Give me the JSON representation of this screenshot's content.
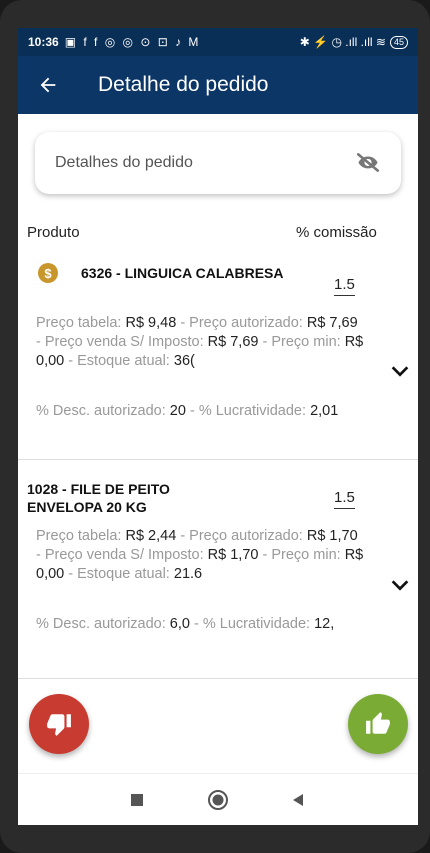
{
  "status_bar": {
    "time": "10:36",
    "left_icons": "▣ f f ◎ ◎ ⊙ ⊡ ♪ M",
    "right_icons": "✱ ⚡ ◷ .ıll .ıll ≋",
    "battery": "45"
  },
  "app_bar": {
    "title": "Detalhe do pedido"
  },
  "details_card": {
    "label": "Detalhes do pedido"
  },
  "columns": {
    "product": "Produto",
    "commission": "% comissão"
  },
  "products": [
    {
      "name": "6326 - LINGUICA CALABRESA",
      "commission": "1.5",
      "labels": {
        "preco_tabela": "Preço tabela:",
        "preco_autorizado": "- Preço autorizado:",
        "preco_venda": "- Preço venda S/ Imposto:",
        "preco_min": "- Preço min:",
        "estoque": "- Estoque atual:",
        "desc": "% Desc. autorizado:",
        "lucratividade": "- % Lucratividade:"
      },
      "values": {
        "preco_tabela": "R$    9,48",
        "preco_autorizado": "R$    7,69",
        "preco_venda": "R$    7,69",
        "preco_min": "R$ 0,00",
        "estoque": "36(",
        "desc": "20",
        "lucratividade": "2,01"
      }
    },
    {
      "name_line1": "1028 - FILE DE PEITO",
      "name_line2": "ENVELOPA 20 KG",
      "commission": "1.5",
      "labels": {
        "preco_tabela": "Preço tabela:",
        "preco_autorizado": "- Preço autorizado:",
        "preco_venda": "- Preço venda S/ Imposto:",
        "preco_min": "- Preço min:",
        "estoque": "- Estoque atual:",
        "desc": "% Desc. autorizado:",
        "lucratividade": "- % Lucratividade:"
      },
      "values": {
        "preco_tabela": "R$    2,44",
        "preco_autorizado": "R$    1,70",
        "preco_venda": "R$    1,70",
        "preco_min": "R$ 0,00",
        "estoque": "21.6",
        "desc": "6,0",
        "lucratividade": "12,"
      }
    }
  ],
  "colors": {
    "app_bar": "#0b3666",
    "reject": "#c83b30",
    "approve": "#7aac35",
    "coin": "#c9962c"
  },
  "icons": {
    "back": "arrow-left-icon",
    "visibility": "eye-off-icon",
    "coin": "dollar-coin-icon",
    "expand": "chevron-down-icon",
    "reject": "thumbs-down-icon",
    "approve": "thumbs-up-icon",
    "nav": [
      "square-icon",
      "circle-icon",
      "triangle-back-icon"
    ]
  },
  "coin_symbol": "$"
}
